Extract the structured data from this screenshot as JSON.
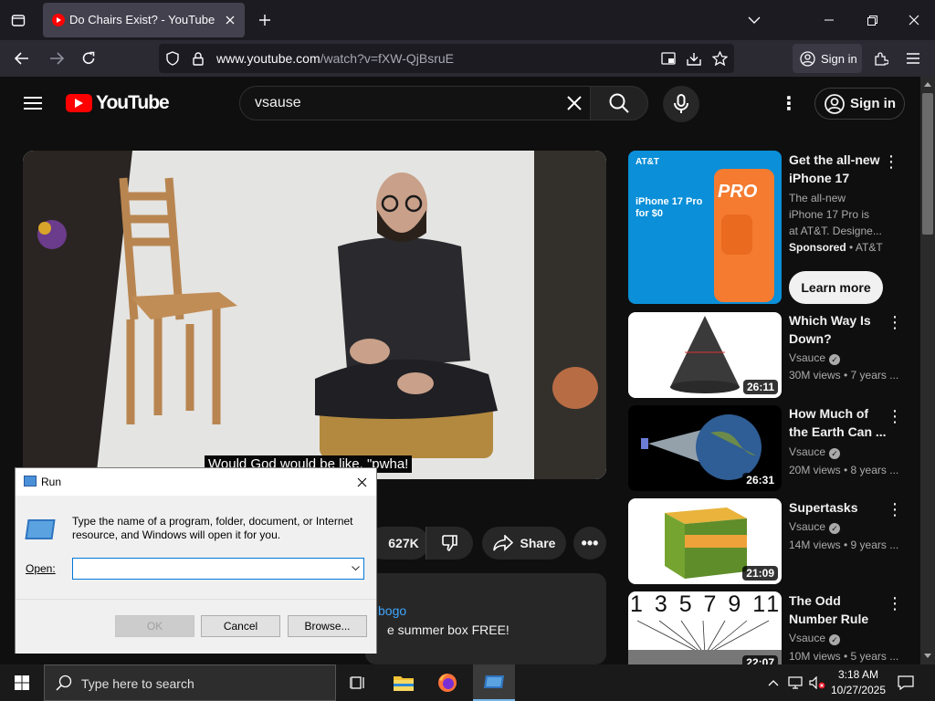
{
  "browser": {
    "tab_title": "Do Chairs Exist? - YouTube",
    "url_host": "www.youtube.com",
    "url_path": "/watch?v=fXW-QjBsruE",
    "sign_in": "Sign in"
  },
  "youtube": {
    "logo_text": "YouTube",
    "search_value": "vsause",
    "sign_in": "Sign in",
    "caption": "Would God would be like, \"pwha!",
    "likes": "627K",
    "share": "Share",
    "desc_link": "bogo",
    "desc_text": "e summer box FREE!",
    "ad": {
      "title": "Get the all-new iPhone 17 Pro...",
      "desc1": "The all-new",
      "desc2": "iPhone 17 Pro is",
      "desc3": "at AT&T. Designe...",
      "sponsored": "Sponsored",
      "advertiser": "AT&T",
      "cta": "Learn more",
      "brand": "AT&T",
      "banner_text": "iPhone 17 Pro for $0",
      "pro": "PRO"
    },
    "videos": [
      {
        "title": "Which Way Is",
        "title2": "Down?",
        "channel": "Vsauce",
        "meta": "30M views • 7 years ...",
        "duration": "26:11"
      },
      {
        "title": "How Much of",
        "title2": "the Earth Can ...",
        "channel": "Vsauce",
        "meta": "20M views • 8 years ...",
        "duration": "26:31"
      },
      {
        "title": "Supertasks",
        "title2": "",
        "channel": "Vsauce",
        "meta": "14M views • 9 years ...",
        "duration": "21:09"
      },
      {
        "title": "The Odd",
        "title2": "Number Rule",
        "channel": "Vsauce",
        "meta": "10M views • 5 years ...",
        "duration": "22:07"
      }
    ],
    "odd_numbers": "1 3 5 7 9 11"
  },
  "run_dialog": {
    "title": "Run",
    "message": "Type the name of a program, folder, document, or Internet resource, and Windows will open it for you.",
    "open_label": "Open:",
    "open_value": "",
    "ok": "OK",
    "cancel": "Cancel",
    "browse": "Browse..."
  },
  "taskbar": {
    "search_placeholder": "Type here to search",
    "time": "3:18 AM",
    "date": "10/27/2025"
  },
  "colors": {
    "yt_red": "#ff0000",
    "accent_blue": "#3ea6ff",
    "att_blue": "#00a8e0",
    "orange": "#f47b30"
  }
}
